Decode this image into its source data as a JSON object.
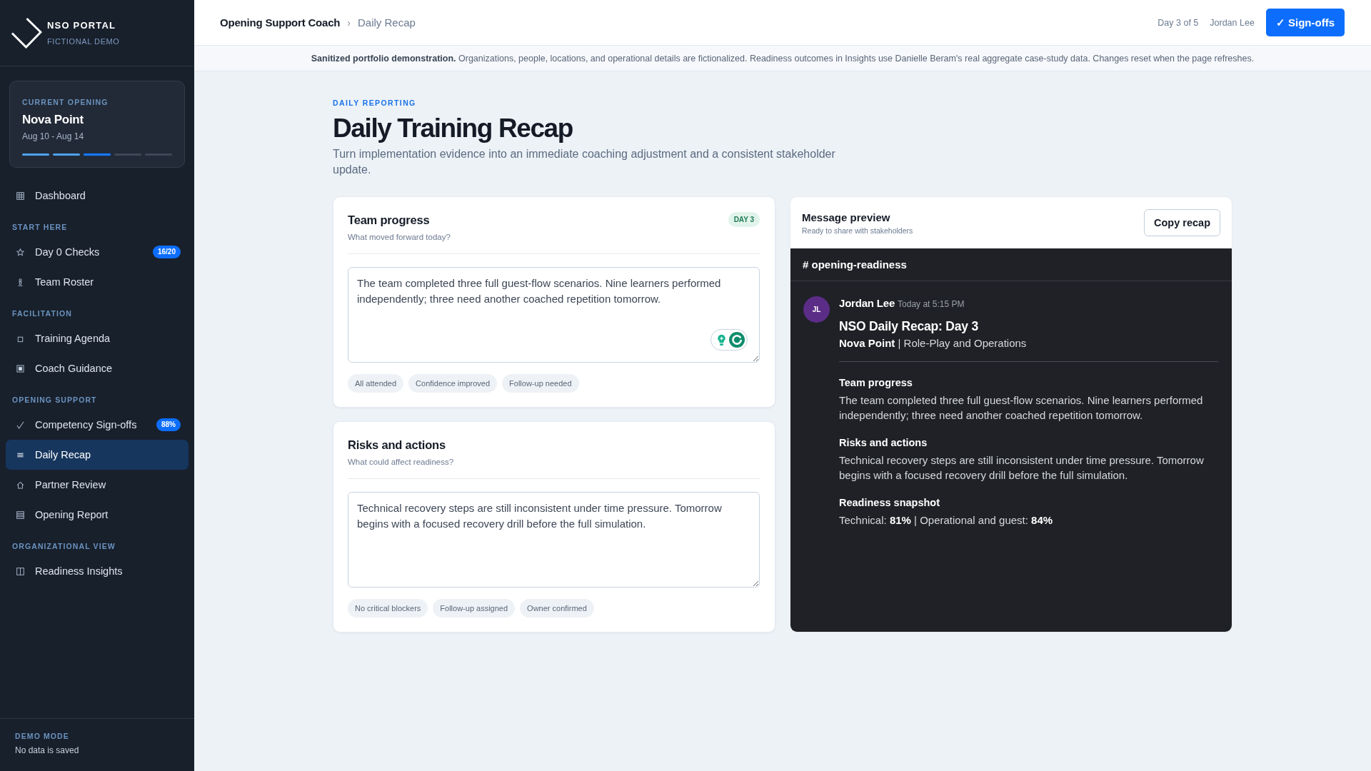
{
  "sidebar": {
    "brand": {
      "title": "NSO PORTAL",
      "subtitle": "FICTIONAL DEMO"
    },
    "current_opening": {
      "label": "CURRENT OPENING",
      "name": "Nova Point",
      "dates": "Aug 10 - Aug 14",
      "days": [
        {
          "complete": true,
          "current": false
        },
        {
          "complete": true,
          "current": false
        },
        {
          "complete": false,
          "current": true
        },
        {
          "complete": false,
          "current": false
        },
        {
          "complete": false,
          "current": false
        }
      ]
    },
    "nav": [
      {
        "items": [
          {
            "label": "Dashboard",
            "selected": false
          }
        ]
      },
      {
        "title": "START HERE",
        "items": [
          {
            "label": "Day 0 Checks",
            "badge": "16/20",
            "selected": false
          },
          {
            "label": "Team Roster",
            "selected": false
          }
        ]
      },
      {
        "title": "FACILITATION",
        "items": [
          {
            "label": "Training Agenda",
            "selected": false
          },
          {
            "label": "Coach Guidance",
            "selected": false
          }
        ]
      },
      {
        "title": "OPENING SUPPORT",
        "items": [
          {
            "label": "Competency Sign-offs",
            "badge": "88%",
            "selected": false
          },
          {
            "label": "Daily Recap",
            "selected": true
          },
          {
            "label": "Partner Review",
            "selected": false
          },
          {
            "label": "Opening Report",
            "selected": false
          }
        ]
      },
      {
        "title": "ORGANIZATIONAL VIEW",
        "items": [
          {
            "label": "Readiness Insights",
            "selected": false
          }
        ]
      }
    ],
    "footer": {
      "label": "DEMO MODE",
      "text": "No data is saved"
    }
  },
  "header": {
    "breadcrumb": [
      {
        "label": "Opening Support Coach",
        "current": false
      },
      {
        "label": "Daily Recap",
        "current": true
      }
    ],
    "separator": "›",
    "day": "Day 3 of 5",
    "user": "Jordan Lee",
    "button": "✓ Sign-offs"
  },
  "notice": "**Sanitized portfolio demonstration.** Organizations, people, locations, and operational details are fictionalized. Readiness outcomes in Insights use Danielle Beram's real aggregate case-study data. Changes reset when the page refreshes.",
  "page": {
    "eyebrow": "DAILY REPORTING",
    "title": "Daily Training Recap",
    "subtitle": "Turn implementation evidence into an immediate coaching adjustment and a consistent stakeholder update."
  },
  "cards": [
    {
      "title": "Team progress",
      "subtitle": "What moved forward today?",
      "badge": "DAY 3",
      "value": "The team completed three full guest-flow scenarios. Nine learners performed independently; three need another coached repetition tomorrow.",
      "writing_assistant": true,
      "chips": [
        "All attended",
        "Confidence improved",
        "Follow-up needed"
      ]
    },
    {
      "title": "Risks and actions",
      "subtitle": "What could affect readiness?",
      "value": "Technical recovery steps are still inconsistent under time pressure. Tomorrow begins with a focused recovery drill before the full simulation.",
      "writing_assistant": false,
      "chips": [
        "No critical blockers",
        "Follow-up assigned",
        "Owner confirmed"
      ]
    }
  ],
  "preview": {
    "title": "Message preview",
    "subtitle": "Ready to share with stakeholders",
    "button": "Copy recap",
    "channel": "# opening-readiness",
    "message": {
      "initials": "JL",
      "author": "Jordan Lee",
      "time": "Today at 5:15 PM",
      "heading": "NSO Daily Recap: Day 3",
      "subheading": "**Nova Point** | Role-Play and Operations",
      "sections": [
        {
          "title": "Team progress",
          "body": "The team completed three full guest-flow scenarios. Nine learners performed independently; three need another coached repetition tomorrow."
        },
        {
          "title": "Risks and actions",
          "body": "Technical recovery steps are still inconsistent under time pressure. Tomorrow begins with a focused recovery drill before the full simulation."
        },
        {
          "title": "Readiness snapshot",
          "body": "Technical: **81%** | Operational and guest: **84%**"
        }
      ]
    }
  }
}
